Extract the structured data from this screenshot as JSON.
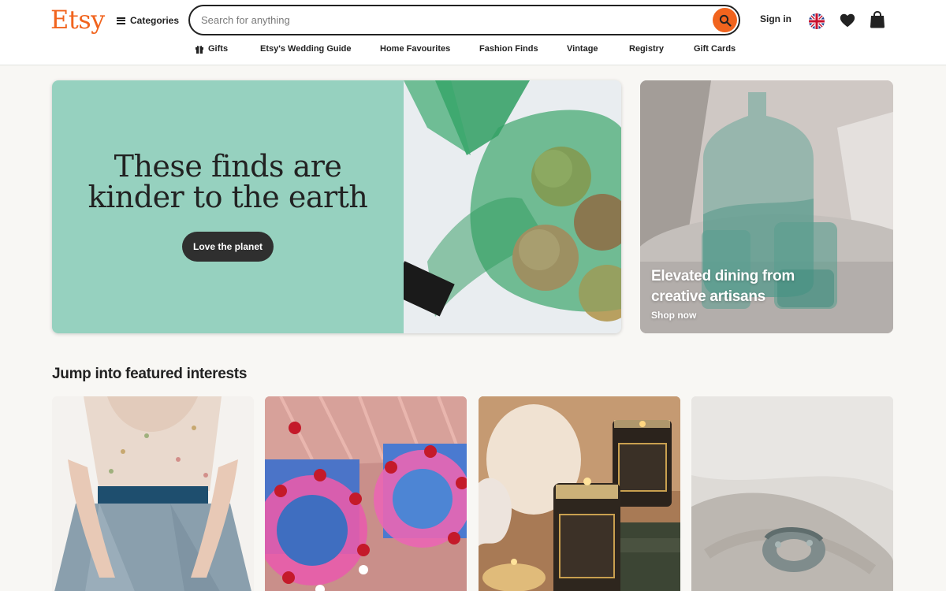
{
  "header": {
    "logo": "Etsy",
    "categories_label": "Categories",
    "search_placeholder": "Search for anything",
    "sign_in": "Sign in"
  },
  "nav": {
    "items": [
      {
        "label": "Gifts",
        "icon": "gift-icon"
      },
      {
        "label": "Etsy's Wedding Guide"
      },
      {
        "label": "Home Favourites"
      },
      {
        "label": "Fashion Finds"
      },
      {
        "label": "Vintage"
      },
      {
        "label": "Registry"
      },
      {
        "label": "Gift Cards"
      }
    ]
  },
  "hero": {
    "title_line1": "These finds are",
    "title_line2": "kinder to the earth",
    "button": "Love the planet",
    "bg_color": "#96d1bf"
  },
  "promo": {
    "title": "Elevated dining from creative artisans",
    "link": "Shop now"
  },
  "featured": {
    "title": "Jump into featured interests",
    "cards": [
      {
        "image": "wedding-dress-image"
      },
      {
        "image": "pink-cakes-image"
      },
      {
        "image": "candles-image"
      },
      {
        "image": "ring-image"
      }
    ]
  },
  "colors": {
    "brand": "#f1641e",
    "text": "#222222",
    "page_bg": "#f8f7f4"
  }
}
